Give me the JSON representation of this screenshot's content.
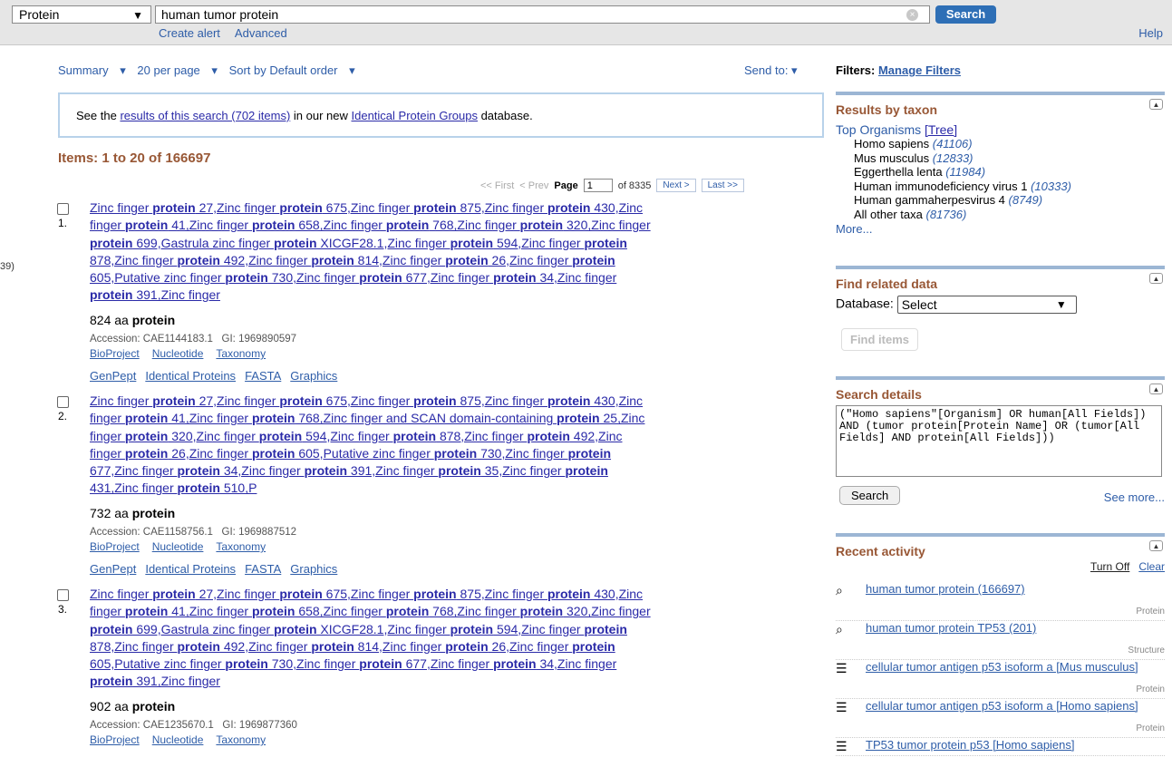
{
  "topbar": {
    "database": "Protein",
    "query": "human tumor protein",
    "search_label": "Search",
    "create_alert": "Create alert",
    "advanced": "Advanced",
    "help": "Help"
  },
  "left_cut": "39)",
  "summary": {
    "format": "Summary",
    "per_page": "20 per page",
    "sort": "Sort by Default order",
    "send_to": "Send to:"
  },
  "notice": {
    "pre": "See the ",
    "link1": "results of this search (702 items)",
    "mid": " in our new ",
    "link2": "Identical Protein Groups",
    "post": " database."
  },
  "items_header": "Items: 1 to 20 of 166697",
  "pager": {
    "first": "<< First",
    "prev": "< Prev",
    "page_label": "Page",
    "page": "1",
    "of": "of 8335",
    "next": "Next >",
    "last": "Last >>"
  },
  "records": [
    {
      "num": "1.",
      "title_lines": [
        "Zinc finger protein 27,Zinc finger protein 675,Zinc finger protein 875,Zinc finger protein 430,Zinc",
        "finger protein 41,Zinc finger protein 658,Zinc finger protein 768,Zinc finger protein 320,Zinc finger",
        "protein 699,Gastrula zinc finger protein XICGF28.1,Zinc finger protein 594,Zinc finger protein",
        "878,Zinc finger protein 492,Zinc finger protein 814,Zinc finger protein 26,Zinc finger protein",
        "605,Putative zinc finger protein 730,Zinc finger protein 677,Zinc finger protein 34,Zinc finger",
        "protein 391,Zinc finger"
      ],
      "aa": "824 aa ",
      "aa_bold": "protein",
      "accession": "Accession: CAE1144183.1   GI: 1969890597",
      "links1": [
        "BioProject",
        "Nucleotide",
        "Taxonomy"
      ],
      "links2": [
        "GenPept",
        "Identical Proteins",
        "FASTA",
        "Graphics"
      ]
    },
    {
      "num": "2.",
      "title_lines": [
        "Zinc finger protein 27,Zinc finger protein 675,Zinc finger protein 875,Zinc finger protein 430,Zinc",
        "finger protein 41,Zinc finger protein 768,Zinc finger and SCAN domain-containing protein 25,Zinc",
        "finger protein 320,Zinc finger protein 594,Zinc finger protein 878,Zinc finger protein 492,Zinc",
        "finger protein 26,Zinc finger protein 605,Putative zinc finger protein 730,Zinc finger protein",
        "677,Zinc finger protein 34,Zinc finger protein 391,Zinc finger protein 35,Zinc finger protein",
        "431,Zinc finger protein 510,P"
      ],
      "aa": "732 aa ",
      "aa_bold": "protein",
      "accession": "Accession: CAE1158756.1   GI: 1969887512",
      "links1": [
        "BioProject",
        "Nucleotide",
        "Taxonomy"
      ],
      "links2": [
        "GenPept",
        "Identical Proteins",
        "FASTA",
        "Graphics"
      ]
    },
    {
      "num": "3.",
      "title_lines": [
        "Zinc finger protein 27,Zinc finger protein 675,Zinc finger protein 875,Zinc finger protein 430,Zinc",
        "finger protein 41,Zinc finger protein 658,Zinc finger protein 768,Zinc finger protein 320,Zinc finger",
        "protein 699,Gastrula zinc finger protein XICGF28.1,Zinc finger protein 594,Zinc finger protein",
        "878,Zinc finger protein 492,Zinc finger protein 814,Zinc finger protein 26,Zinc finger protein",
        "605,Putative zinc finger protein 730,Zinc finger protein 677,Zinc finger protein 34,Zinc finger",
        "protein 391,Zinc finger"
      ],
      "aa": "902 aa ",
      "aa_bold": "protein",
      "accession": "Accession: CAE1235670.1   GI: 1969877360",
      "links1": [
        "BioProject",
        "Nucleotide",
        "Taxonomy"
      ],
      "links2": []
    }
  ],
  "filters": {
    "label": "Filters: ",
    "manage": "Manage Filters"
  },
  "taxon": {
    "title": "Results by taxon",
    "top": "Top Organisms",
    "tree": "[Tree]",
    "organisms": [
      {
        "name": "Homo sapiens",
        "count": "(41106)"
      },
      {
        "name": "Mus musculus",
        "count": "(12833)"
      },
      {
        "name": "Eggerthella lenta",
        "count": "(11984)"
      },
      {
        "name": "Human immunodeficiency virus 1",
        "count": "(10333)"
      },
      {
        "name": "Human gammaherpesvirus 4",
        "count": "(8749)"
      },
      {
        "name": "All other taxa",
        "count": "(81736)"
      }
    ],
    "more": "More..."
  },
  "related": {
    "title": "Find related data",
    "db_label": "Database:",
    "db_value": "Select",
    "find": "Find items"
  },
  "details": {
    "title": "Search details",
    "query": "(\"Homo sapiens\"[Organism] OR human[All Fields]) AND (tumor protein[Protein Name] OR (tumor[All Fields] AND protein[All Fields]))",
    "search": "Search",
    "see_more": "See more..."
  },
  "recent": {
    "title": "Recent activity",
    "turn_off": "Turn Off",
    "clear": "Clear",
    "items": [
      {
        "icon": "search-icon",
        "text": "human tumor protein (166697)",
        "db": "Protein"
      },
      {
        "icon": "search-icon",
        "text": "human tumor protein TP53 (201)",
        "db": "Structure"
      },
      {
        "icon": "document-icon",
        "text": "cellular tumor antigen p53 isoform a [Mus musculus]",
        "db": "Protein"
      },
      {
        "icon": "document-icon",
        "text": "cellular tumor antigen p53 isoform a [Homo sapiens]",
        "db": "Protein"
      },
      {
        "icon": "document-icon",
        "text": "TP53 tumor protein p53 [Homo sapiens]",
        "db": ""
      }
    ]
  }
}
